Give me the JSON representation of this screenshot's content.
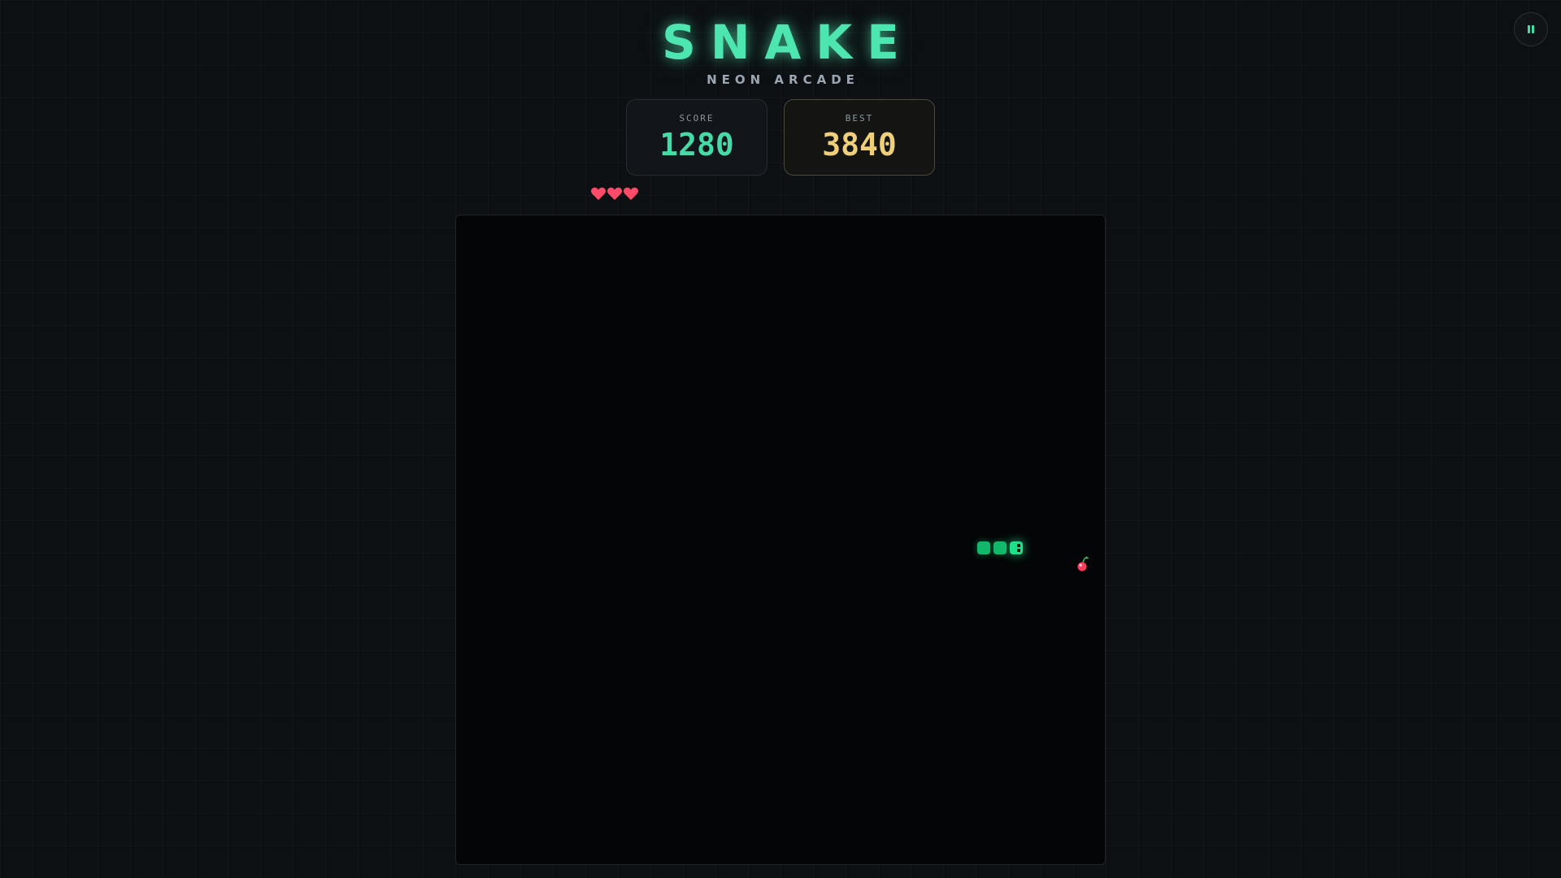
{
  "title": "SNAKE",
  "subtitle": "NEON ARCADE",
  "score": {
    "label": "SCORE",
    "value": "1280"
  },
  "best": {
    "label": "BEST",
    "value": "3840"
  },
  "lives": {
    "count": 3,
    "icon": "heart-icon",
    "color": "#ff4a6a"
  },
  "pause_button": {
    "icon": "pause-icon"
  },
  "board": {
    "snake": {
      "segments": 3,
      "direction": "right",
      "color": "#11b86a",
      "head_color": "#1ee08a"
    },
    "food": {
      "icon": "cherry-icon",
      "color": "#ff3b5c"
    }
  },
  "colors": {
    "background": "#0d1013",
    "board_background": "#040506",
    "accent": "#4ee6b0",
    "score": "#46dba6",
    "best": "#f0cf7a"
  }
}
